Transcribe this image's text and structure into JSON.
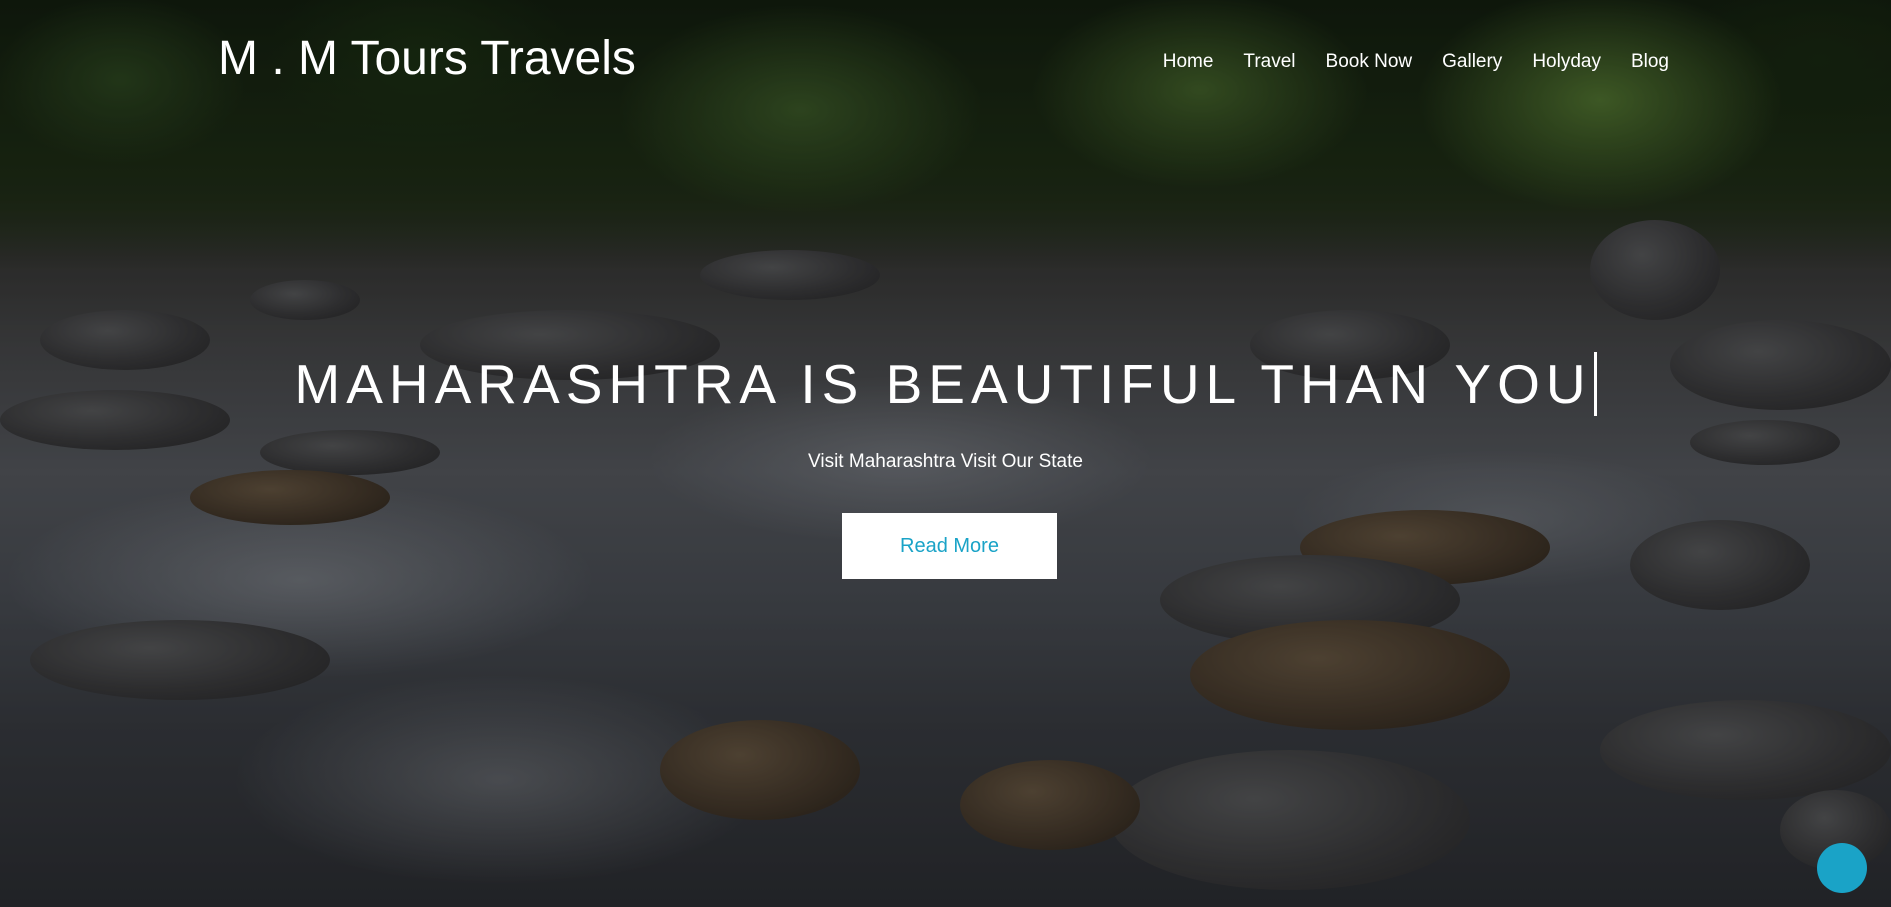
{
  "header": {
    "logo_text": "M . M Tours Travels",
    "nav": [
      {
        "label": "Home"
      },
      {
        "label": "Travel"
      },
      {
        "label": "Book Now"
      },
      {
        "label": "Gallery"
      },
      {
        "label": "Holyday"
      },
      {
        "label": "Blog"
      }
    ]
  },
  "hero": {
    "headline": "MAHARASHTRA IS BEAUTIFUL THAN YOU",
    "subtitle": "Visit Maharashtra Visit Our State",
    "button_label": "Read More",
    "background_icon": "river-landscape-image"
  },
  "chat": {
    "icon": "chat-bubble-icon"
  },
  "colors": {
    "accent": "#1aa3c7",
    "text": "#ffffff",
    "button_bg": "#ffffff"
  }
}
